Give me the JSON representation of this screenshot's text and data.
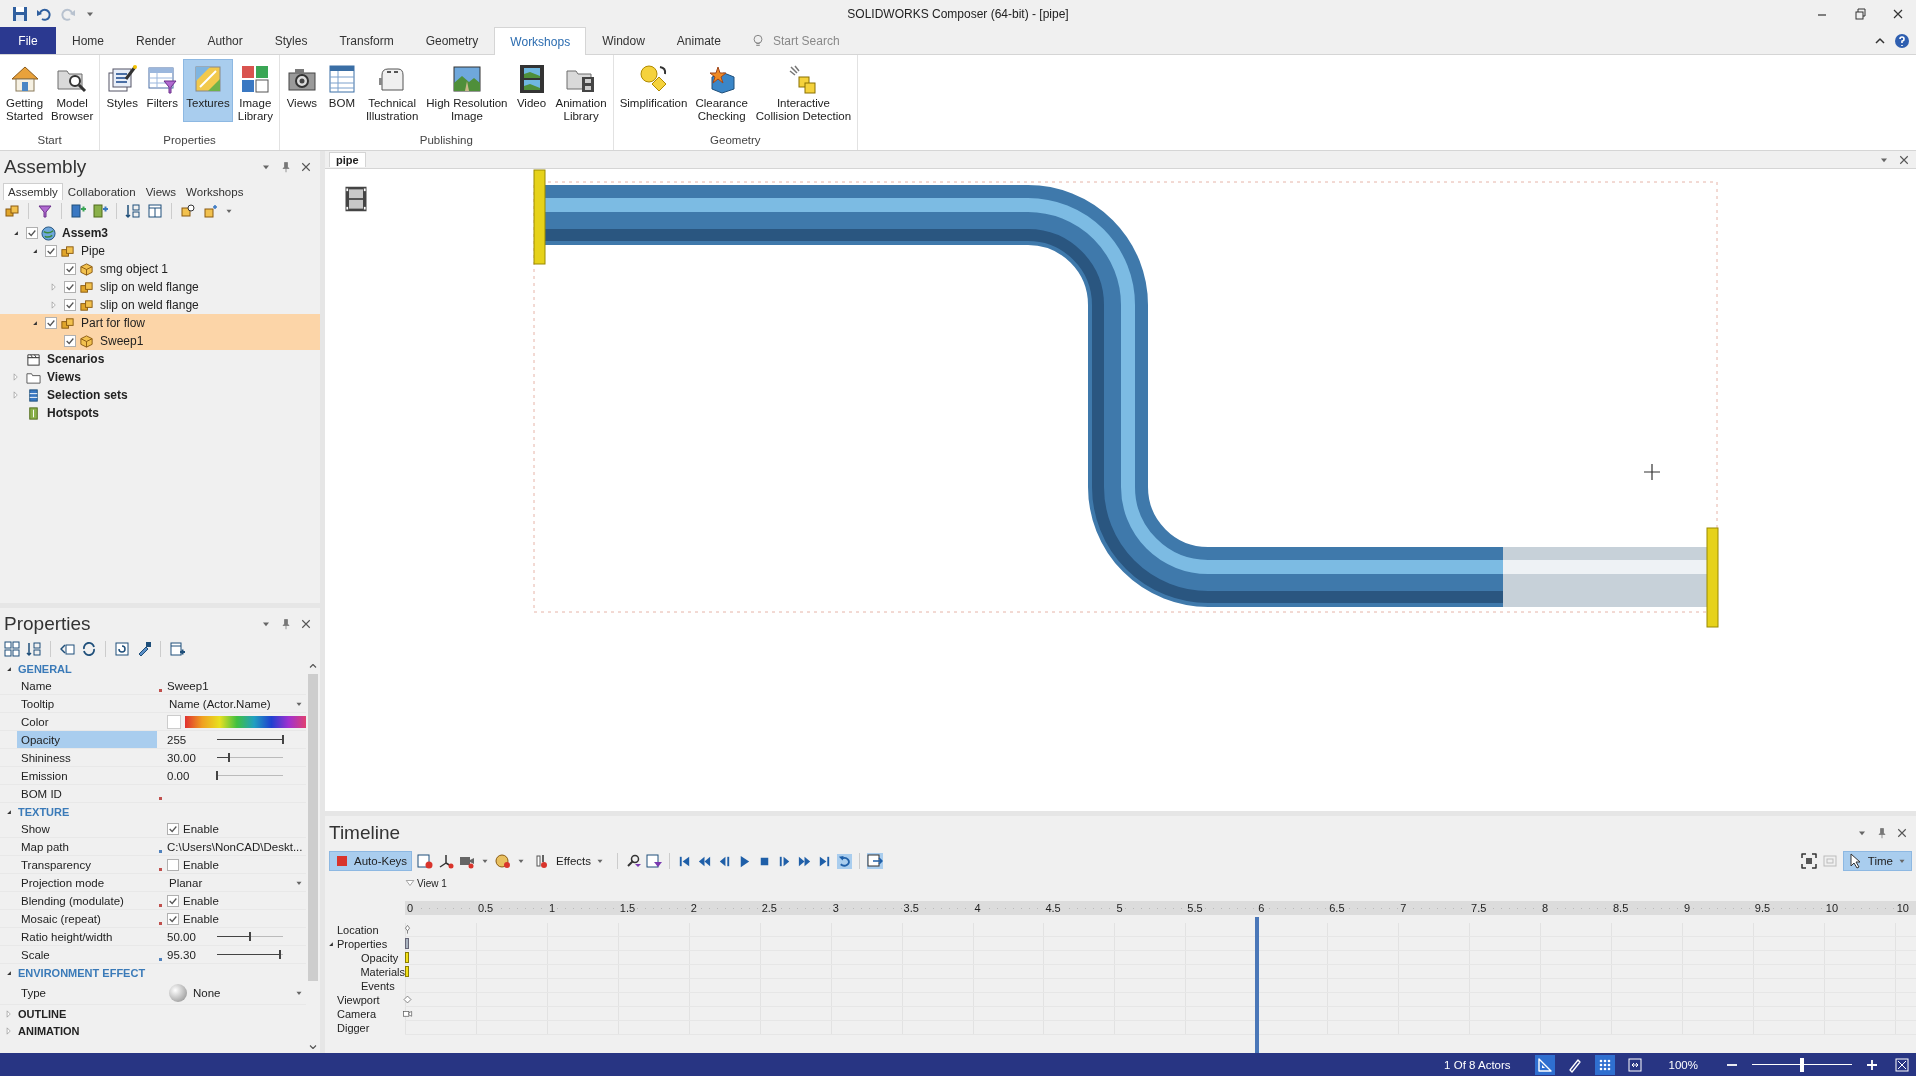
{
  "window": {
    "title": "SOLIDWORKS Composer (64-bit) - [pipe]"
  },
  "ribbon_tabs": [
    {
      "label": "File",
      "kind": "file",
      "selected": false
    },
    {
      "label": "Home",
      "kind": "tab",
      "selected": false
    },
    {
      "label": "Render",
      "kind": "tab",
      "selected": false
    },
    {
      "label": "Author",
      "kind": "tab",
      "selected": false
    },
    {
      "label": "Styles",
      "kind": "tab",
      "selected": false
    },
    {
      "label": "Transform",
      "kind": "tab",
      "selected": false
    },
    {
      "label": "Geometry",
      "kind": "tab",
      "selected": false
    },
    {
      "label": "Workshops",
      "kind": "tab",
      "selected": true
    },
    {
      "label": "Window",
      "kind": "tab",
      "selected": false
    },
    {
      "label": "Animate",
      "kind": "tab",
      "selected": false
    }
  ],
  "search": {
    "placeholder": "Start Search"
  },
  "ribbon_groups": [
    {
      "title": "Start",
      "buttons": [
        {
          "label": "Getting\nStarted",
          "selected": false
        },
        {
          "label": "Model\nBrowser",
          "selected": false
        }
      ]
    },
    {
      "title": "Properties",
      "buttons": [
        {
          "label": "Styles",
          "selected": false
        },
        {
          "label": "Filters",
          "selected": false
        },
        {
          "label": "Textures",
          "selected": true
        },
        {
          "label": "Image\nLibrary",
          "selected": false
        }
      ]
    },
    {
      "title": "Publishing",
      "buttons": [
        {
          "label": "Views",
          "selected": false
        },
        {
          "label": "BOM",
          "selected": false
        },
        {
          "label": "Technical\nIllustration",
          "selected": false
        },
        {
          "label": "High Resolution\nImage",
          "selected": false
        },
        {
          "label": "Video",
          "selected": false
        },
        {
          "label": "Animation\nLibrary",
          "selected": false
        }
      ]
    },
    {
      "title": "Geometry",
      "buttons": [
        {
          "label": "Simplification",
          "selected": false
        },
        {
          "label": "Clearance\nChecking",
          "selected": false
        },
        {
          "label": "Interactive\nCollision Detection",
          "selected": false
        }
      ]
    }
  ],
  "assembly_panel": {
    "title": "Assembly",
    "tabs": [
      {
        "label": "Assembly",
        "selected": true
      },
      {
        "label": "Collaboration",
        "selected": false
      },
      {
        "label": "Views",
        "selected": false
      },
      {
        "label": "Workshops",
        "selected": false
      }
    ],
    "tree": [
      {
        "label": "Assem3",
        "kind": "root",
        "checked": true,
        "expanded": true,
        "selected": false,
        "children": [
          {
            "label": "Pipe",
            "kind": "assembly",
            "checked": true,
            "expanded": true,
            "selected": false,
            "children": [
              {
                "label": "smg object 1",
                "kind": "part",
                "checked": true,
                "selected": false
              },
              {
                "label": "slip on weld flange",
                "kind": "assembly",
                "checked": true,
                "expanded": false,
                "selected": false
              },
              {
                "label": "slip on weld flange",
                "kind": "assembly",
                "checked": true,
                "expanded": false,
                "selected": false
              }
            ]
          },
          {
            "label": "Part for flow",
            "kind": "assembly",
            "checked": true,
            "expanded": true,
            "selected": true,
            "children": [
              {
                "label": "Sweep1",
                "kind": "part",
                "checked": true,
                "selected": true
              }
            ]
          }
        ]
      },
      {
        "label": "Scenarios",
        "kind": "scenarios",
        "selected": false
      },
      {
        "label": "Views",
        "kind": "folder",
        "expanded": false,
        "selected": false
      },
      {
        "label": "Selection sets",
        "kind": "selection",
        "expanded": false,
        "selected": false
      },
      {
        "label": "Hotspots",
        "kind": "hotspot",
        "selected": false
      }
    ]
  },
  "document": {
    "tab": "pipe"
  },
  "properties_panel": {
    "title": "Properties",
    "sections": [
      {
        "title": "GENERAL",
        "expanded": true,
        "rows": [
          {
            "label": "Name",
            "kind": "text",
            "value": "Sweep1",
            "color": "#c0504d",
            "selected": false
          },
          {
            "label": "Tooltip",
            "kind": "dropdown",
            "value": "Name (Actor.Name)",
            "selected": false
          },
          {
            "label": "Color",
            "kind": "color",
            "selected": false
          },
          {
            "label": "Opacity",
            "kind": "slider",
            "value": "255",
            "level": 1.0,
            "selected": true
          },
          {
            "label": "Shininess",
            "kind": "slider",
            "value": "30.00",
            "level": 0.18,
            "selected": false
          },
          {
            "label": "Emission",
            "kind": "slider",
            "value": "0.00",
            "level": 0.0,
            "selected": false
          },
          {
            "label": "BOM ID",
            "kind": "empty",
            "color": "#c0504d",
            "selected": false
          }
        ]
      },
      {
        "title": "TEXTURE",
        "expanded": true,
        "rows": [
          {
            "label": "Show",
            "kind": "checkbox",
            "value": "Enable",
            "checked": true,
            "selected": false
          },
          {
            "label": "Map path",
            "kind": "text",
            "value": "C:\\Users\\NonCAD\\Deskt...",
            "color": "#4f81bd",
            "selected": false
          },
          {
            "label": "Transparency",
            "kind": "checkbox",
            "value": "Enable",
            "checked": false,
            "color": "#c0504d",
            "selected": false
          },
          {
            "label": "Projection mode",
            "kind": "dropdown",
            "value": "Planar",
            "selected": false
          },
          {
            "label": "Blending (modulate)",
            "kind": "checkbox",
            "value": "Enable",
            "checked": true,
            "color": "#c0504d",
            "selected": false
          },
          {
            "label": "Mosaic (repeat)",
            "kind": "checkbox",
            "value": "Enable",
            "checked": true,
            "color": "#c0504d",
            "selected": false
          },
          {
            "label": "Ratio height/width",
            "kind": "slider",
            "value": "50.00",
            "level": 0.5,
            "selected": false
          },
          {
            "label": "Scale",
            "kind": "slider",
            "value": "95.30",
            "level": 0.95,
            "color": "#4f81bd",
            "selected": false
          }
        ]
      },
      {
        "title": "ENVIRONMENT EFFECT",
        "expanded": true,
        "rows": [
          {
            "label": "Type",
            "kind": "environment",
            "value": "None",
            "selected": false
          }
        ]
      },
      {
        "title": "OUTLINE",
        "expanded": false
      },
      {
        "title": "ANIMATION",
        "expanded": false
      }
    ]
  },
  "timeline": {
    "title": "Timeline",
    "auto_keys": {
      "label": "Auto-Keys",
      "selected": true
    },
    "effects": {
      "label": "Effects"
    },
    "mode": {
      "label": "Time",
      "selected": true
    },
    "view_marker": "View 1",
    "ruler": [
      "0",
      "0.5",
      "1",
      "1.5",
      "2",
      "2.5",
      "3",
      "3.5",
      "4",
      "4.5",
      "5",
      "5.5",
      "6",
      "6.5",
      "7",
      "7.5",
      "8",
      "8.5",
      "9",
      "9.5",
      "10",
      "10"
    ],
    "playhead": {
      "level": 0.5714
    },
    "tracks": [
      {
        "label": "Location",
        "kind": "pin"
      },
      {
        "label": "Properties",
        "kind": "group",
        "expanded": true,
        "children": [
          {
            "label": "Opacity",
            "kind": "key"
          },
          {
            "label": "Materials",
            "kind": "key"
          },
          {
            "label": "Events",
            "kind": "none"
          }
        ]
      },
      {
        "label": "Viewport",
        "kind": "diamond"
      },
      {
        "label": "Camera",
        "kind": "camera"
      },
      {
        "label": "Digger",
        "kind": "none"
      }
    ]
  },
  "status_bar": {
    "actors": "1 Of 8 Actors",
    "zoom": "100%",
    "zoom_slider": {
      "level": 0.5
    }
  }
}
